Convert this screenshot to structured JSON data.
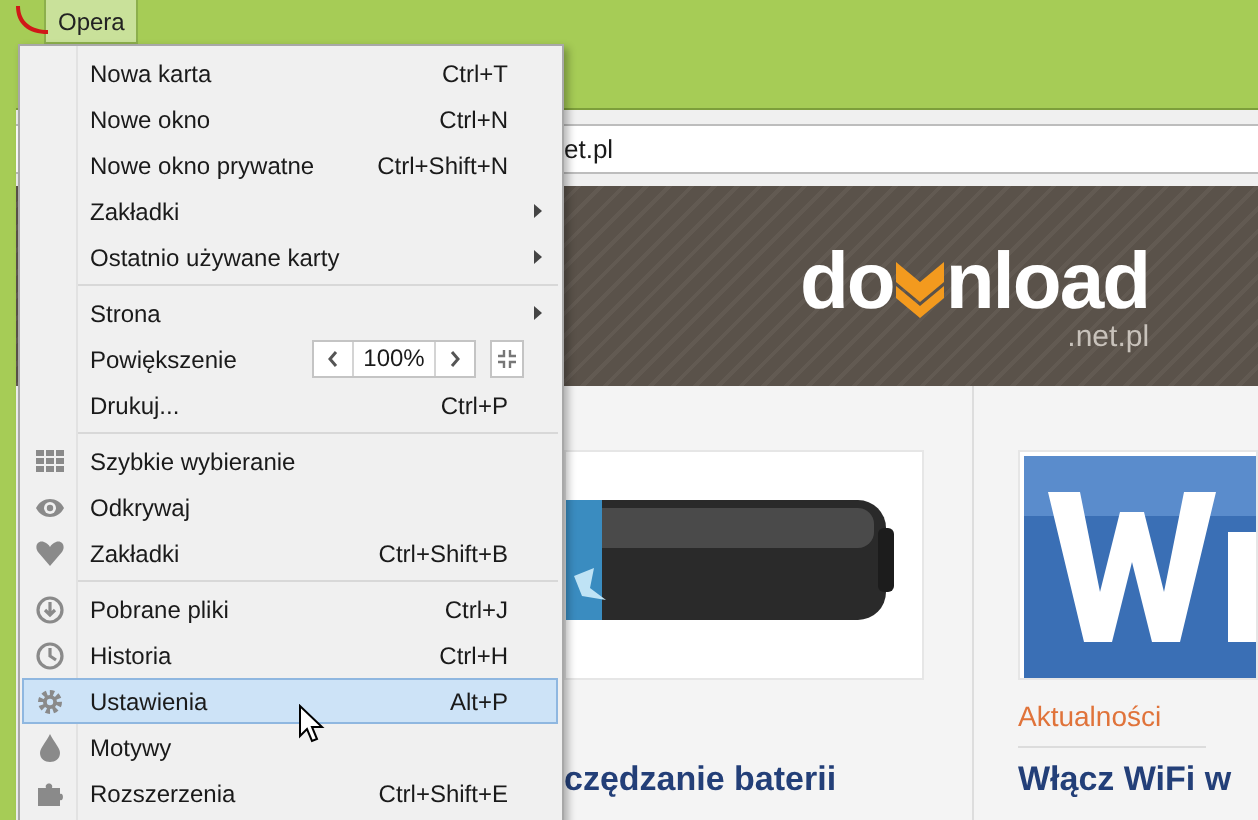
{
  "app_button": {
    "label": "Opera"
  },
  "address_bar": {
    "value": "et.pl"
  },
  "banner": {
    "logo_start": "do",
    "logo_end": "nload",
    "logo_suffix": ".net.pl"
  },
  "articles": [
    {
      "kind": "picture",
      "title": "czędzanie baterii"
    },
    {
      "kind": "picture",
      "category": "Aktualności",
      "title": "Włącz WiFi w"
    }
  ],
  "menu": {
    "sections": [
      {
        "items": [
          {
            "kind": "item",
            "label": "Nowa karta",
            "shortcut": "Ctrl+T",
            "submenu": false,
            "selected": false
          },
          {
            "kind": "item",
            "label": "Nowe okno",
            "shortcut": "Ctrl+N",
            "submenu": false,
            "selected": false
          },
          {
            "kind": "item",
            "label": "Nowe okno prywatne",
            "shortcut": "Ctrl+Shift+N",
            "submenu": false,
            "selected": false
          },
          {
            "kind": "item",
            "label": "Zakładki",
            "submenu": true,
            "selected": false
          },
          {
            "kind": "item",
            "label": "Ostatnio używane karty",
            "submenu": true,
            "selected": false
          }
        ]
      },
      {
        "items": [
          {
            "kind": "item",
            "label": "Strona",
            "submenu": true,
            "selected": false
          },
          {
            "kind": "zoom",
            "label": "Powiększenie",
            "value": "100%",
            "selected": false
          },
          {
            "kind": "item",
            "label": "Drukuj...",
            "shortcut": "Ctrl+P",
            "submenu": false,
            "selected": false
          }
        ]
      },
      {
        "items": [
          {
            "kind": "item",
            "label": "Szybkie wybieranie",
            "submenu": false,
            "selected": false
          },
          {
            "kind": "item",
            "label": "Odkrywaj",
            "submenu": false,
            "selected": false
          },
          {
            "kind": "item",
            "label": "Zakładki",
            "shortcut": "Ctrl+Shift+B",
            "submenu": false,
            "selected": false
          }
        ]
      },
      {
        "items": [
          {
            "kind": "item",
            "label": "Pobrane pliki",
            "shortcut": "Ctrl+J",
            "submenu": false,
            "selected": false
          },
          {
            "kind": "item",
            "label": "Historia",
            "shortcut": "Ctrl+H",
            "submenu": false,
            "selected": false
          },
          {
            "kind": "item",
            "label": "Ustawienia",
            "shortcut": "Alt+P",
            "submenu": false,
            "selected": true
          },
          {
            "kind": "item",
            "label": "Motywy",
            "submenu": false,
            "selected": false
          },
          {
            "kind": "item",
            "label": "Rozszerzenia",
            "shortcut": "Ctrl+Shift+E",
            "submenu": false,
            "selected": false
          }
        ]
      }
    ]
  }
}
